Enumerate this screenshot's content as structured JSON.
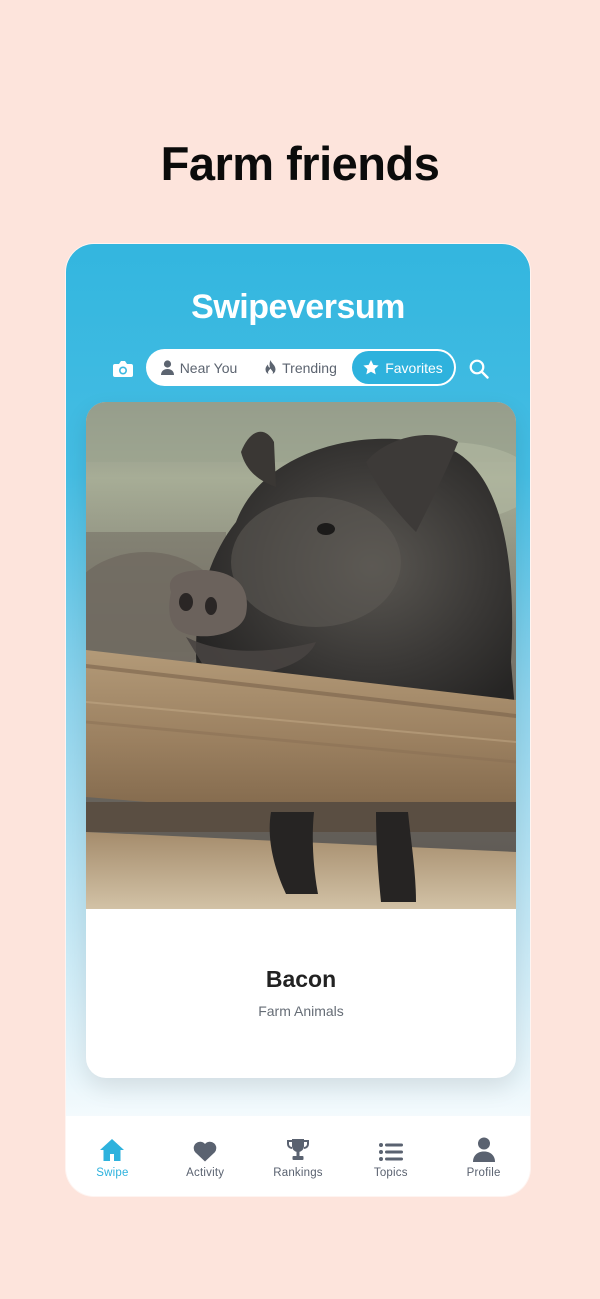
{
  "headline": "Farm friends",
  "app": {
    "brand": "Swipeversum",
    "accent_color": "#2eb2dd",
    "header_icons": {
      "left": "camera-icon",
      "right": "search-icon"
    },
    "filters": [
      {
        "label": "Near You",
        "icon": "person-icon",
        "selected": false
      },
      {
        "label": "Trending",
        "icon": "flame-icon",
        "selected": false
      },
      {
        "label": "Favorites",
        "icon": "star-icon",
        "selected": true
      }
    ],
    "card": {
      "image": "photo of a dark pig leaning over a wooden fence",
      "title": "Bacon",
      "subtitle": "Farm Animals"
    },
    "tabs": [
      {
        "label": "Swipe",
        "icon": "home-icon",
        "active": true
      },
      {
        "label": "Activity",
        "icon": "heart-icon",
        "active": false
      },
      {
        "label": "Rankings",
        "icon": "trophy-icon",
        "active": false
      },
      {
        "label": "Topics",
        "icon": "list-icon",
        "active": false
      },
      {
        "label": "Profile",
        "icon": "person-icon",
        "active": false
      }
    ]
  }
}
